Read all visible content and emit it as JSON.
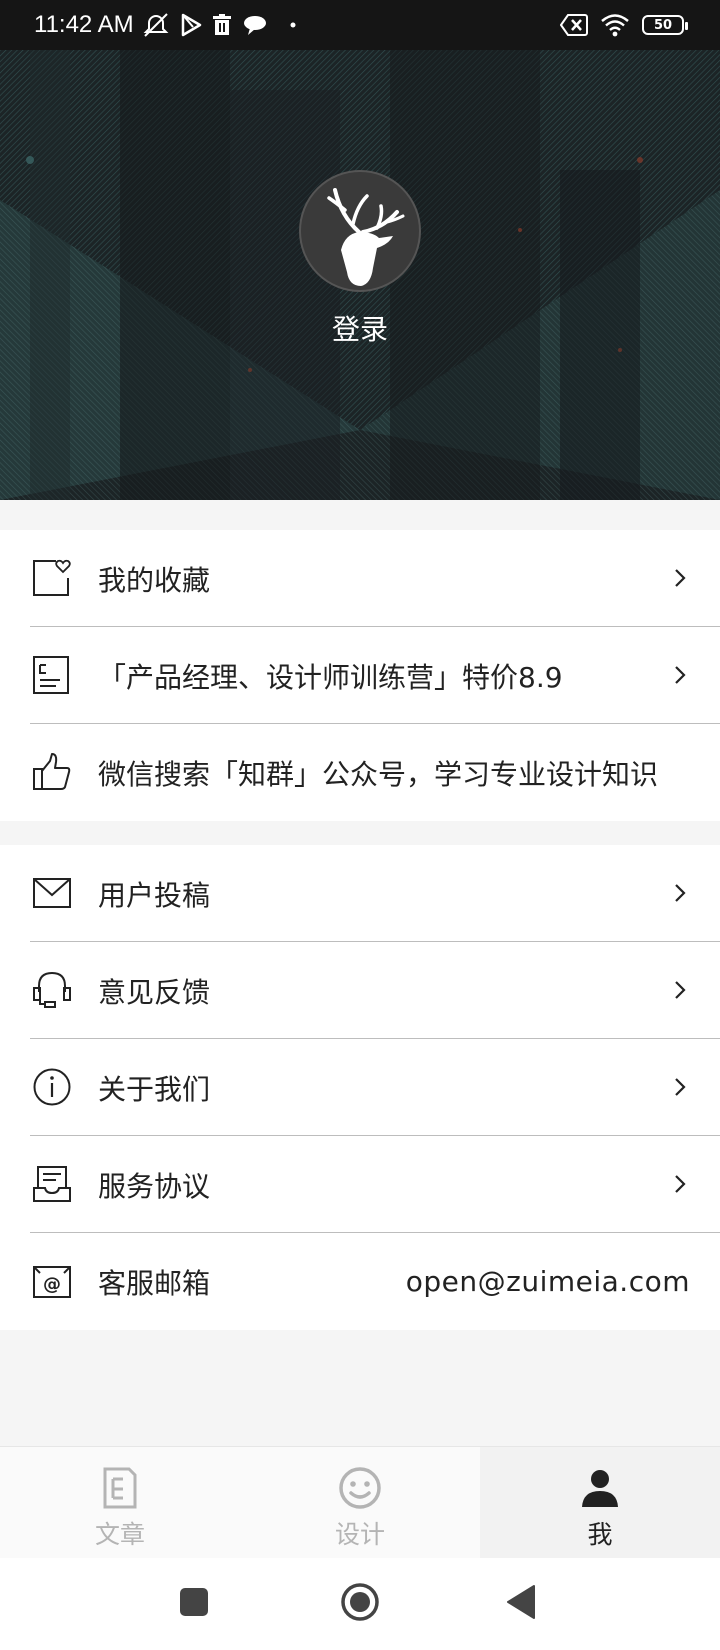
{
  "status_bar": {
    "time": "11:42 AM",
    "left_icons": [
      "muted-alarm-icon",
      "play-store-icon",
      "trash-icon",
      "cloud-chat-icon",
      "dot-icon"
    ],
    "right_icons": [
      "no-sim-icon",
      "wifi-icon",
      "battery-icon"
    ],
    "battery_level": "50"
  },
  "header": {
    "avatar_icon": "deer-icon",
    "login_label": "登录"
  },
  "group1": {
    "items": [
      {
        "icon": "favorite-icon",
        "label": "我的收藏",
        "chevron": true
      },
      {
        "icon": "document-icon",
        "label": "「产品经理、设计师训练营」特价8.9",
        "chevron": true
      },
      {
        "icon": "thumbs-up-icon",
        "label": "微信搜索「知群」公众号，学习专业设计知识",
        "chevron": false
      }
    ]
  },
  "group2": {
    "items": [
      {
        "icon": "mail-icon",
        "label": "用户投稿",
        "chevron": true
      },
      {
        "icon": "headset-icon",
        "label": "意见反馈",
        "chevron": true
      },
      {
        "icon": "info-icon",
        "label": "关于我们",
        "chevron": true
      },
      {
        "icon": "inbox-icon",
        "label": "服务协议",
        "chevron": true
      },
      {
        "icon": "email-at-icon",
        "label": "客服邮箱",
        "value": "open@zuimeia.com"
      }
    ]
  },
  "tabbar": {
    "tabs": [
      {
        "icon": "article-icon",
        "label": "文章",
        "active": false
      },
      {
        "icon": "smiley-icon",
        "label": "设计",
        "active": false
      },
      {
        "icon": "person-icon",
        "label": "我",
        "active": true
      }
    ]
  },
  "navbar": {
    "buttons": [
      "recents-button",
      "home-button",
      "back-button"
    ]
  }
}
